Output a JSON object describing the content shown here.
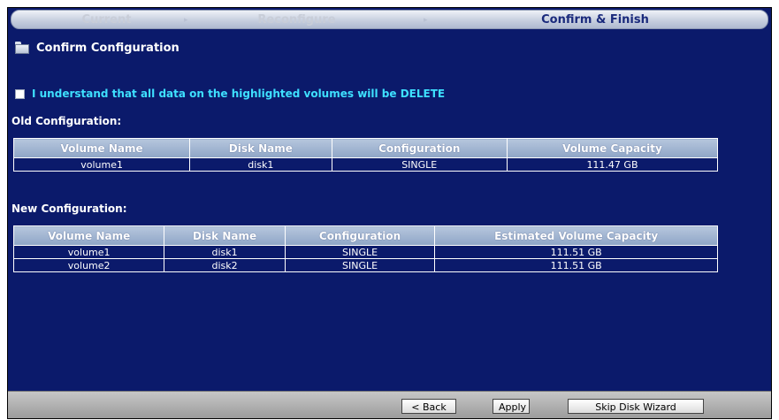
{
  "wizard": {
    "steps": [
      "Current",
      "Reconfigure",
      "Confirm & Finish"
    ],
    "arrow": "▸"
  },
  "section": {
    "title": "Confirm Configuration"
  },
  "confirm": {
    "text": "I understand that all data on the highlighted volumes will be DELETE"
  },
  "old_config": {
    "label": "Old Configuration:",
    "headers": [
      "Volume Name",
      "Disk Name",
      "Configuration",
      "Volume Capacity"
    ],
    "rows": [
      [
        "volume1",
        "disk1",
        "SINGLE",
        "111.47 GB"
      ]
    ]
  },
  "new_config": {
    "label": "New Configuration:",
    "headers": [
      "Volume Name",
      "Disk Name",
      "Configuration",
      "Estimated Volume Capacity"
    ],
    "rows": [
      [
        "volume1",
        "disk1",
        "SINGLE",
        "111.51 GB"
      ],
      [
        "volume2",
        "disk2",
        "SINGLE",
        "111.51 GB"
      ]
    ]
  },
  "buttons": {
    "back": "< Back",
    "apply": "Apply",
    "skip": "Skip Disk Wizard"
  }
}
